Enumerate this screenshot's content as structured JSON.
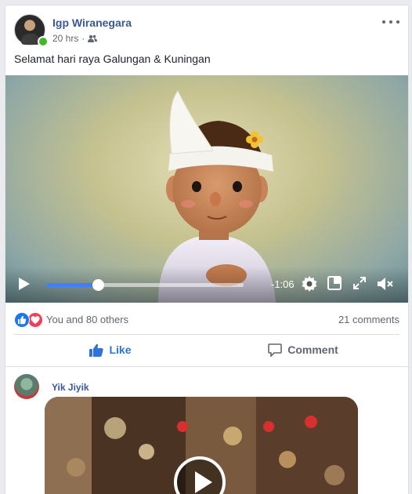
{
  "post": {
    "author": "Igp Wiranegara",
    "time": "20 hrs",
    "separator": "·",
    "audience_icon": "friends-icon",
    "text": "Selamat hari raya Galungan & Kuningan",
    "more_icon": "more-options-icon"
  },
  "video": {
    "progress": 0.26,
    "time_remaining": "-1:06",
    "controls": [
      "play-icon",
      "settings-icon",
      "picture-in-picture-icon",
      "fullscreen-icon",
      "muted-volume-icon"
    ],
    "accent_color": "#4080ff"
  },
  "reactions": {
    "icons": [
      "like-reaction-icon",
      "love-reaction-icon"
    ],
    "text": "You and 80 others",
    "comments": "21 comments"
  },
  "actions": {
    "like_label": "Like",
    "comment_label": "Comment"
  },
  "comment": {
    "author": "Yik Jiyik"
  },
  "colors": {
    "link": "#385898",
    "like_active": "#2d74da",
    "online": "#42b72a"
  }
}
